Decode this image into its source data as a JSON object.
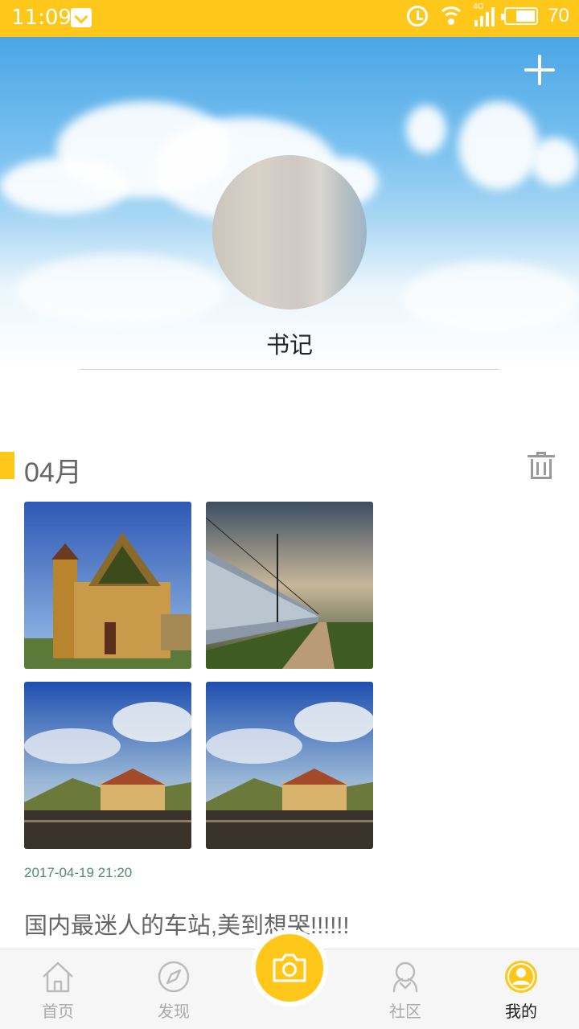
{
  "status_bar": {
    "time": "11:09",
    "network": "4G",
    "battery_level": "70",
    "accent_color": "#ffc71a"
  },
  "header": {
    "add_icon": "plus-icon",
    "username": "书记"
  },
  "timeline": {
    "month": "04月",
    "delete_icon": "trash-icon",
    "posts": [
      {
        "photos": [
          {
            "icon": "photo-station-building"
          },
          {
            "icon": "photo-train-at-sunset"
          },
          {
            "icon": "photo-station-landscape"
          },
          {
            "icon": "photo-station-landscape"
          }
        ],
        "date": "2017-04-19 21:20",
        "text": "国内最迷人的车站,美到想哭!!!!!!"
      }
    ]
  },
  "tab_bar": {
    "tabs": [
      {
        "label": "首页",
        "icon": "home-icon",
        "active": false
      },
      {
        "label": "发现",
        "icon": "compass-icon",
        "active": false
      },
      {
        "label": "",
        "icon": "camera-icon",
        "active": false
      },
      {
        "label": "社区",
        "icon": "community-icon",
        "active": false
      },
      {
        "label": "我的",
        "icon": "profile-icon",
        "active": true
      }
    ]
  }
}
